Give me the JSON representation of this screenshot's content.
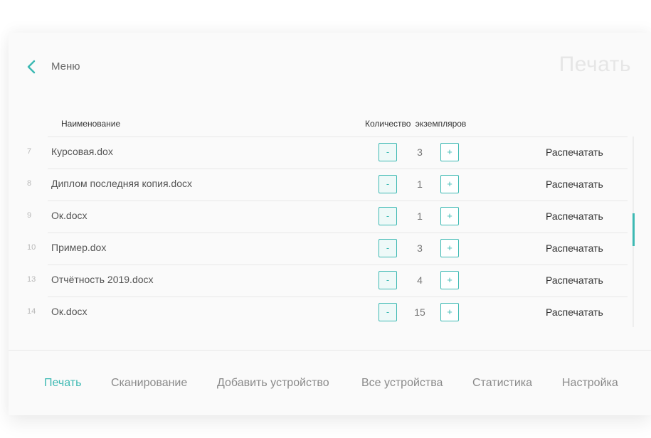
{
  "header": {
    "back_icon": "chevron-left-icon",
    "menu_label": "Меню",
    "title": "Печать"
  },
  "table": {
    "col_name": "Наименование",
    "col_qty": "Количество экземпляров",
    "rows": [
      {
        "num": "7",
        "name": "Курсовая.dox",
        "qty": "3",
        "action": "Распечатать"
      },
      {
        "num": "8",
        "name": "Диплом последняя копия.docx",
        "qty": "1",
        "action": "Распечатать"
      },
      {
        "num": "9",
        "name": "Ок.docx",
        "qty": "1",
        "action": "Распечатать"
      },
      {
        "num": "10",
        "name": "Пример.dox",
        "qty": "3",
        "action": "Распечатать"
      },
      {
        "num": "13",
        "name": "Отчётность 2019.docx",
        "qty": "4",
        "action": "Распечатать"
      },
      {
        "num": "14",
        "name": "Ок.docx",
        "qty": "15",
        "action": "Распечатать"
      }
    ],
    "minus_label": "-",
    "plus_label": "+"
  },
  "nav": {
    "items": [
      {
        "label": "Печать",
        "active": true
      },
      {
        "label": "Сканирование",
        "active": false
      },
      {
        "label": "Добавить устройство",
        "active": false
      },
      {
        "label": "Все устройства",
        "active": false
      },
      {
        "label": "Статистика",
        "active": false
      },
      {
        "label": "Настройка",
        "active": false
      }
    ]
  },
  "colors": {
    "accent": "#3db9b3",
    "text": "#555555",
    "muted": "#8a8a8a"
  }
}
